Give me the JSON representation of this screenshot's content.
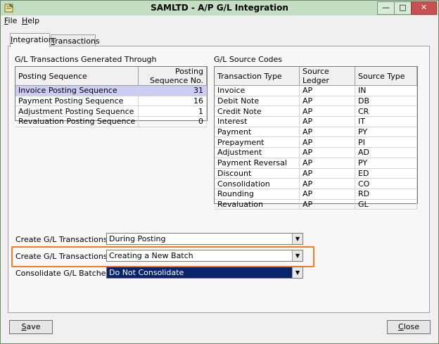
{
  "window": {
    "title": "SAMLTD - A/P G/L Integration",
    "min_glyph": "—",
    "max_glyph": "□",
    "close_glyph": "✕"
  },
  "menu": {
    "file_mnemonic": "F",
    "file_rest": "ile",
    "help_mnemonic": "H",
    "help_rest": "elp"
  },
  "tabs": {
    "integration_mnemonic": "I",
    "integration_rest": "ntegration",
    "transactions_mnemonic": "T",
    "transactions_rest": "ransactions"
  },
  "posting": {
    "section_title": "G/L Transactions Generated Through",
    "col_sequence": "Posting Sequence",
    "col_number": "Posting Sequence No.",
    "rows": [
      {
        "name": "Invoice Posting Sequence",
        "number": "31"
      },
      {
        "name": "Payment Posting Sequence",
        "number": "16"
      },
      {
        "name": "Adjustment Posting Sequence",
        "number": "1"
      },
      {
        "name": "Revaluation Posting Sequence",
        "number": "0"
      }
    ]
  },
  "source_codes": {
    "section_title": "G/L Source Codes",
    "col_type": "Transaction Type",
    "col_ledger": "Source Ledger",
    "col_source_type": "Source Type",
    "rows": [
      {
        "type": "Invoice",
        "ledger": "AP",
        "source": "IN"
      },
      {
        "type": "Debit Note",
        "ledger": "AP",
        "source": "DB"
      },
      {
        "type": "Credit Note",
        "ledger": "AP",
        "source": "CR"
      },
      {
        "type": "Interest",
        "ledger": "AP",
        "source": "IT"
      },
      {
        "type": "Payment",
        "ledger": "AP",
        "source": "PY"
      },
      {
        "type": "Prepayment",
        "ledger": "AP",
        "source": "PI"
      },
      {
        "type": "Adjustment",
        "ledger": "AP",
        "source": "AD"
      },
      {
        "type": "Payment Reversal",
        "ledger": "AP",
        "source": "PY"
      },
      {
        "type": "Discount",
        "ledger": "AP",
        "source": "ED"
      },
      {
        "type": "Consolidation",
        "ledger": "AP",
        "source": "CO"
      },
      {
        "type": "Rounding",
        "ledger": "AP",
        "source": "RD"
      },
      {
        "type": "Revaluation",
        "ledger": "AP",
        "source": "GL"
      }
    ]
  },
  "options": {
    "create_label": "Create G/L Transactions",
    "create_value": "During Posting",
    "by_label": "Create G/L Transactions By",
    "by_value": "Creating a New Batch",
    "consolidate_label": "Consolidate G/L Batches",
    "consolidate_value": "Do Not Consolidate",
    "highlight_color": "#f07c2a"
  },
  "buttons": {
    "save_mnemonic": "S",
    "save_rest": "ave",
    "close_mnemonic": "C",
    "close_rest": "lose"
  },
  "icons": {
    "app": "app-icon",
    "dropdown": "chevron-down-icon"
  }
}
